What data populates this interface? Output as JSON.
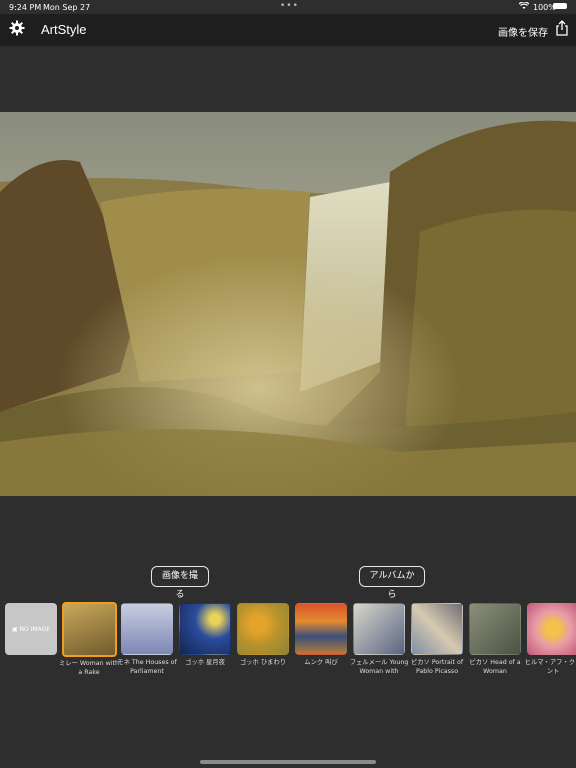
{
  "status": {
    "time": "9:24 PM",
    "date": "Mon Sep 27",
    "battery": "100%",
    "dots": "•••"
  },
  "nav": {
    "title": "ArtStyle",
    "save_label": "画像を保存"
  },
  "actions": {
    "take_photo": "画像を撮る",
    "from_album": "アルバムから"
  },
  "styles": [
    {
      "label": "",
      "image": "NO IMAGE"
    },
    {
      "label": "ミレー Woman with a Rake",
      "selected": true
    },
    {
      "label": "モネ The Houses of Parliament"
    },
    {
      "label": "ゴッホ 星月夜"
    },
    {
      "label": "ゴッホ ひまわり"
    },
    {
      "label": "ムンク 叫び"
    },
    {
      "label": "フェルメール Young Woman with"
    },
    {
      "label": "ピカソ Portrait of Pablo Picasso"
    },
    {
      "label": "ピカソ Head of a Woman"
    },
    {
      "label": "ヒルマ・アフ・クリント"
    }
  ]
}
